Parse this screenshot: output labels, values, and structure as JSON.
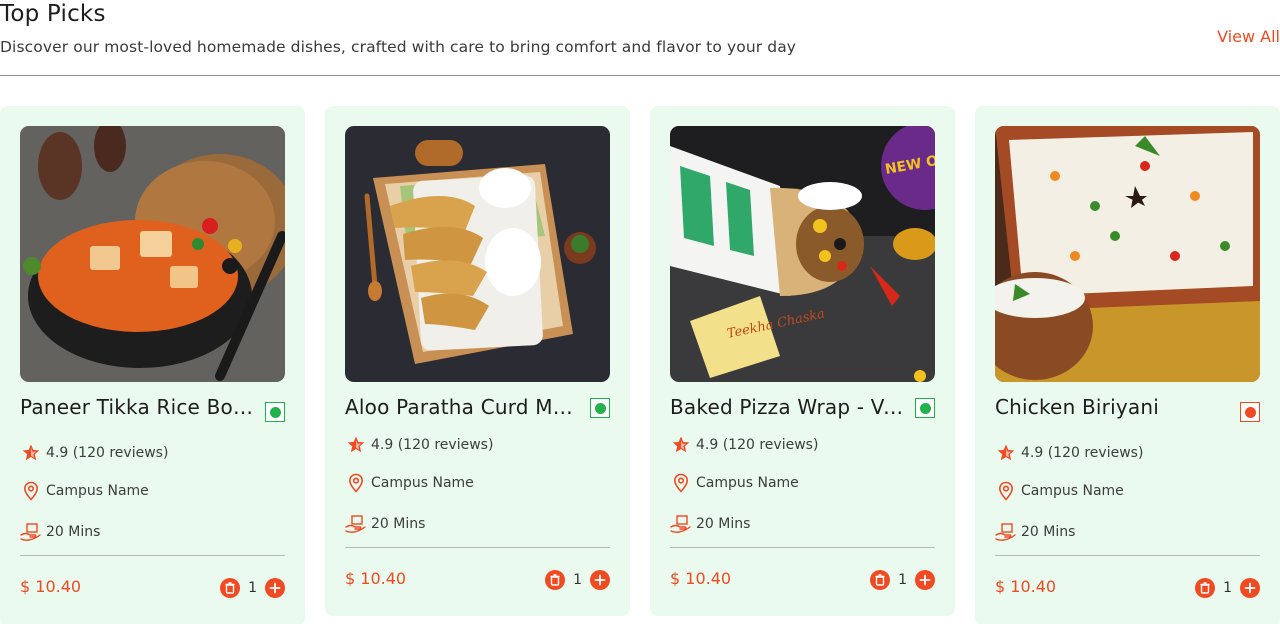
{
  "section": {
    "title": "Top Picks",
    "subtitle": "Discover our most-loved homemade dishes, crafted with care to bring comfort and flavor to your day",
    "view_all_label": "View All"
  },
  "colors": {
    "accent": "#f04a22",
    "card_bg": "#eafaee",
    "veg": "#22b24c",
    "nonveg": "#f04a22"
  },
  "cards": [
    {
      "name": "Paneer Tikka Rice Bowl",
      "diet": "veg",
      "rating": "4.9 (120 reviews)",
      "campus": "Campus Name",
      "time": "20 Mins",
      "price": "$ 10.40",
      "quantity": "1",
      "image": "paneer-tikka-rice-bowl-photo"
    },
    {
      "name": "Aloo Paratha Curd Meal",
      "diet": "veg",
      "rating": "4.9 (120 reviews)",
      "campus": "Campus Name",
      "time": "20 Mins",
      "price": "$ 10.40",
      "quantity": "1",
      "image": "aloo-paratha-curd-photo"
    },
    {
      "name": "Baked Pizza Wrap - Veg",
      "diet": "veg",
      "rating": "4.9 (120 reviews)",
      "campus": "Campus Name",
      "time": "20 Mins",
      "price": "$ 10.40",
      "quantity": "1",
      "image": "baked-pizza-wrap-photo",
      "image_badge": "NEW ON MENU",
      "image_packet_text": "Teekha Chaska"
    },
    {
      "name": "Chicken Biriyani",
      "diet": "nonveg",
      "rating": "4.9 (120 reviews)",
      "campus": "Campus Name",
      "time": "20 Mins",
      "price": "$ 10.40",
      "quantity": "1",
      "image": "chicken-biriyani-photo"
    }
  ]
}
